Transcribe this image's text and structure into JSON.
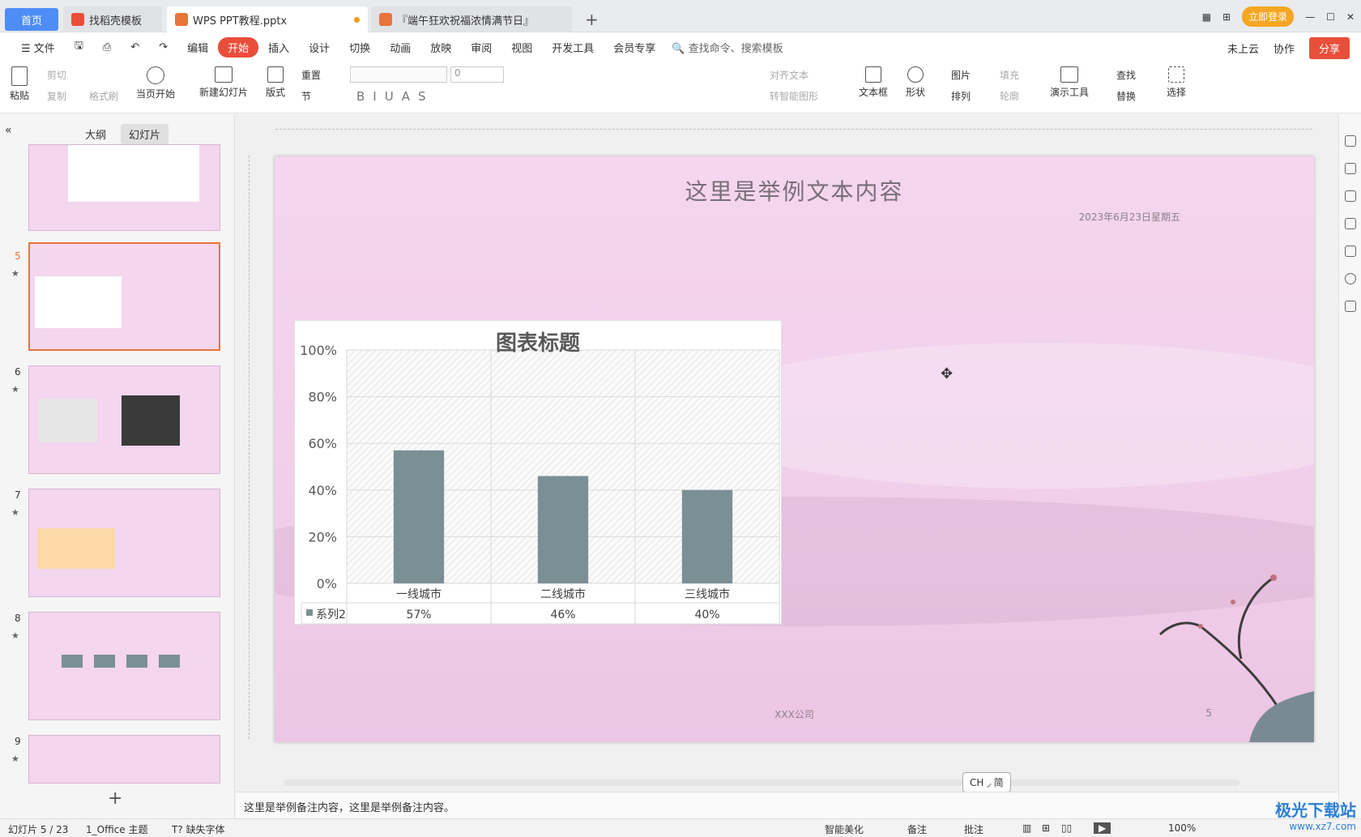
{
  "tabs": {
    "home": "首页",
    "t1": "找稻壳模板",
    "t2": "WPS PPT教程.pptx",
    "t3": "『端午狂欢祝福浓情满节日』",
    "add": "+"
  },
  "window": {
    "login": "立即登录"
  },
  "menu": {
    "file": "文件",
    "edit": "编辑",
    "items": [
      "开始",
      "插入",
      "设计",
      "切换",
      "动画",
      "放映",
      "审阅",
      "视图",
      "开发工具",
      "会员专享"
    ],
    "search": "查找命令、搜索模板",
    "cloud": "未上云",
    "collab": "协作",
    "share": "分享"
  },
  "ribbon": {
    "paste": "粘贴",
    "cut": "剪切",
    "copy": "复制",
    "format_painter": "格式刷",
    "from_current": "当页开始",
    "new_slide": "新建幻灯片",
    "layout": "版式",
    "section": "节",
    "reset": "重置",
    "font_size": "0",
    "text_direction": "对齐文本",
    "smart_art": "转智能图形",
    "textbox": "文本框",
    "shape": "形状",
    "picture": "图片",
    "arrange": "排列",
    "fill": "填充",
    "outline": "轮廓",
    "present_tool": "演示工具",
    "find": "查找",
    "replace": "替换",
    "select": "选择"
  },
  "left_panel": {
    "tab_outline": "大纲",
    "tab_slides": "幻灯片",
    "slides": [
      "5",
      "6",
      "7",
      "8",
      "9"
    ]
  },
  "slide": {
    "title": "这里是举例文本内容",
    "date": "2023年6月23日星期五",
    "footer": "XXX公司",
    "number": "5"
  },
  "chart_data": {
    "type": "bar",
    "title": "图表标题",
    "categories": [
      "一线城市",
      "二线城市",
      "三线城市"
    ],
    "series": [
      {
        "name": "系列2",
        "values": [
          57,
          46,
          40
        ]
      }
    ],
    "ylim": [
      0,
      100
    ],
    "yticks": [
      "0%",
      "20%",
      "40%",
      "60%",
      "80%",
      "100%"
    ],
    "data_labels": [
      "57%",
      "46%",
      "40%"
    ],
    "colors": {
      "bar": "#7a9095"
    }
  },
  "notes": "这里是举例备注内容，这里是举例备注内容。",
  "status": {
    "slide_index": "幻灯片 5 / 23",
    "theme": "1_Office 主题",
    "missing_font": "缺失字体",
    "beautify": "智能美化",
    "notes": "备注",
    "comments": "批注",
    "zoom": "100%"
  },
  "ime": "CH ◞ 简",
  "watermark": {
    "name": "极光下载站",
    "url": "www.xz7.com"
  }
}
